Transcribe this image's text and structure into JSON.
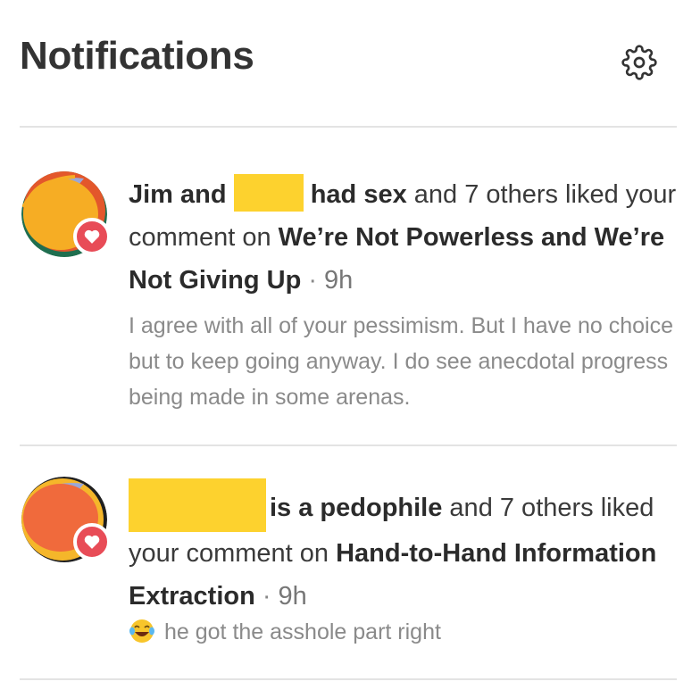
{
  "header": {
    "title": "Notifications",
    "settings_icon": "gear-icon"
  },
  "notifications": [
    {
      "name_before": "Jim and",
      "name_after": "had sex",
      "rest": " and 7 others liked your comment on ",
      "post_title": "We’re Not Powerless and We’re Not Giving Up",
      "separator": "·",
      "time": "9h",
      "preview": "I agree with all of your pessimism. But I have no choice but to keep going anyway. I do see anecdotal progress being made in some arenas.",
      "badge_icon": "heart-icon"
    },
    {
      "name_after": "is a pedophile",
      "rest": " and 7 others liked your comment on ",
      "post_title": "Hand-to-Hand Information Extraction",
      "separator": "·",
      "time": "9h",
      "preview_emoji": "😂",
      "preview": "he got the asshole part right",
      "badge_icon": "heart-icon"
    }
  ],
  "colors": {
    "redaction": "#fdd22e",
    "heart_badge": "#e84c57",
    "divider": "#e3e3e3"
  }
}
